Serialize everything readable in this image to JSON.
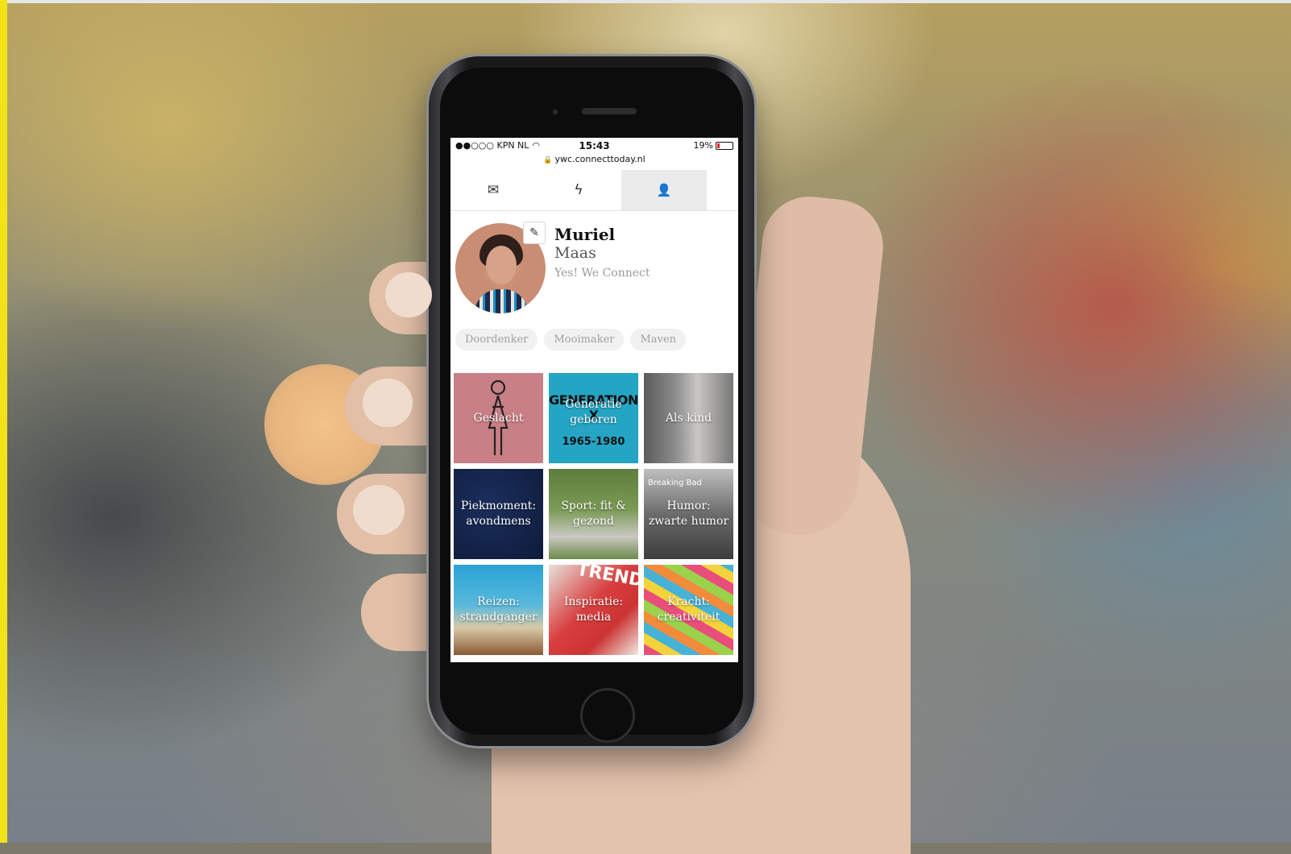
{
  "status_bar": {
    "carrier": "●●○○○ KPN NL",
    "time": "15:43",
    "battery": "19%",
    "battery_level": 0.19,
    "url": "ywc.connecttoday.nl"
  },
  "tabs": [
    {
      "icon": "envelope-icon",
      "glyph": "✉"
    },
    {
      "icon": "lightning-icon",
      "glyph": "ϟ"
    },
    {
      "icon": "user-icon",
      "glyph": "👤",
      "active": true
    }
  ],
  "profile": {
    "first_name": "Muriel",
    "last_name": "Maas",
    "company": "Yes! We Connect",
    "edit_glyph": "✎"
  },
  "tags": [
    "Doordenker",
    "Mooimaker",
    "Maven"
  ],
  "tiles": [
    {
      "label": "Geslacht"
    },
    {
      "label": "Generatie geboren",
      "overlay_title": "GENERATION X",
      "overlay_years": "1965-1980"
    },
    {
      "label": "Als kind"
    },
    {
      "label": "Piekmoment: avondmens"
    },
    {
      "label": "Sport: fit & gezond"
    },
    {
      "label": "Humor: zwarte humor",
      "overlay_text": "Breaking Bad"
    },
    {
      "label": "Reizen: strandganger"
    },
    {
      "label": "Inspiratie: media",
      "overlay_text": "TRENDS"
    },
    {
      "label": "Kracht: creativiteit"
    }
  ],
  "colors": {
    "accent_yellow": "#f2e21a",
    "tile_pink": "#c97f86",
    "tile_blue": "#24a5c4"
  }
}
